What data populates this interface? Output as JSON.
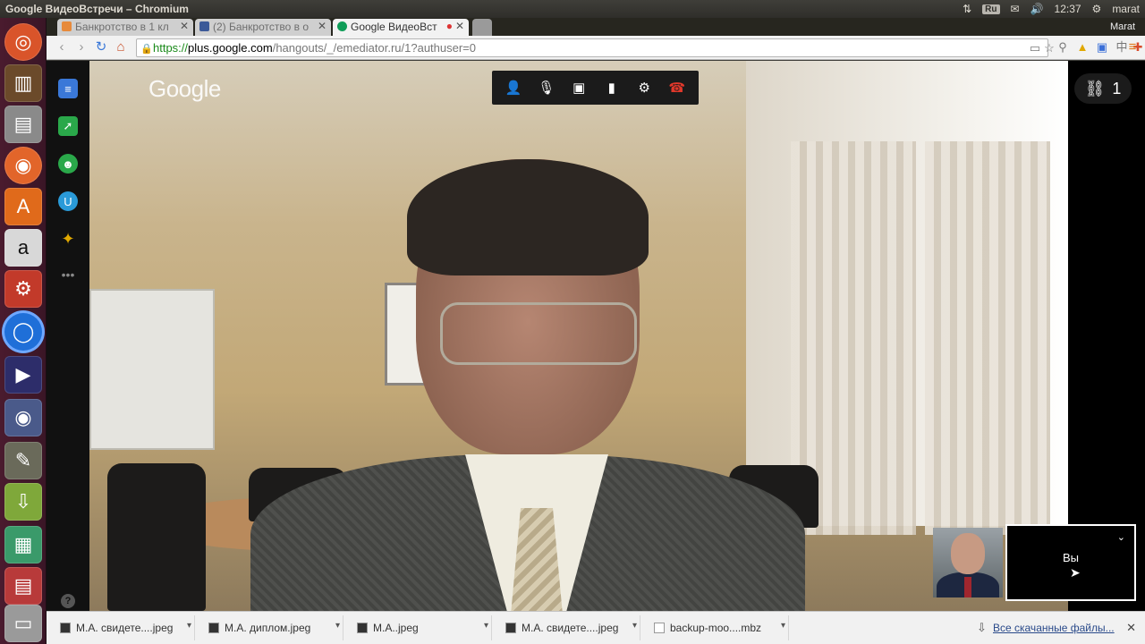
{
  "window": {
    "title": "Google ВидеоВстречи – Chromium"
  },
  "tray": {
    "lang": "Ru",
    "time": "12:37",
    "user": "marat"
  },
  "tabs": [
    {
      "label": "Банкротство в 1 кл",
      "icon_color": "#e78a3b"
    },
    {
      "label": "(2) Банкротство в о",
      "icon_color": "#3b5998"
    },
    {
      "label": "Google ВидеоВст",
      "icon_color": "#0f9d58"
    }
  ],
  "chrome_user": "Marat",
  "omnibox": {
    "scheme": "https://",
    "host": "plus.google.com",
    "path": "/hangouts/_/emediator.ru/1?authuser=0"
  },
  "hangout": {
    "logo": "Google",
    "participants_count": "1",
    "self_label": "Вы"
  },
  "downloads": {
    "items": [
      {
        "name": "М.А. свидете....jpeg"
      },
      {
        "name": "М.А. диплом.jpeg"
      },
      {
        "name": "М.А..jpeg"
      },
      {
        "name": "М.А. свидете....jpeg"
      },
      {
        "name": "backup-moo....mbz"
      }
    ],
    "all_label": "Все скачанные файлы..."
  }
}
